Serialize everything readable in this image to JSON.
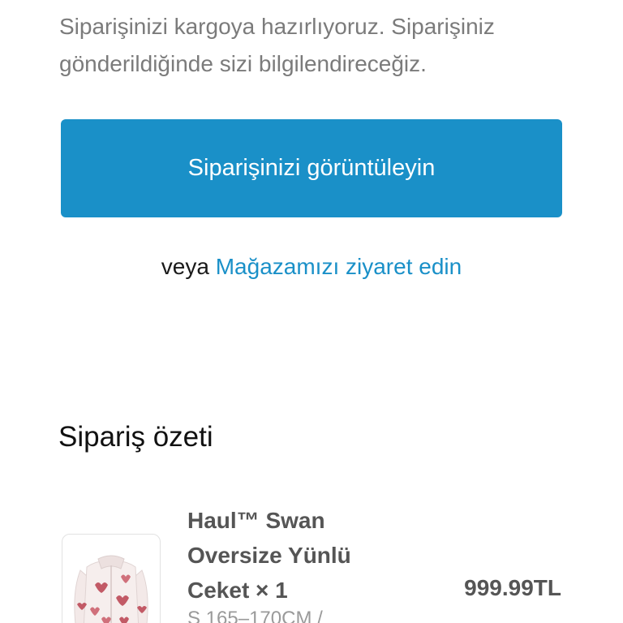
{
  "message": "Siparişinizi kargoya hazırlıyoruz. Siparişiniz gönderildiğinde sizi bilgilendireceğiz.",
  "view_order_button": "Siparişinizi görüntüleyin",
  "alternative": {
    "or": "veya",
    "visit_store_link": "Mağazamızı ziyaret edin"
  },
  "summary": {
    "title": "Sipariş özeti",
    "items": [
      {
        "name": "Haul™ Swan Oversize Yünlü Ceket",
        "quantity": "× 1",
        "variant": "S 165–170CM /",
        "price": "999.99TL"
      }
    ]
  },
  "colors": {
    "accent": "#1a90c8",
    "body_text": "#7b7b7b",
    "heading_text": "#111111",
    "product_text": "#555555"
  }
}
